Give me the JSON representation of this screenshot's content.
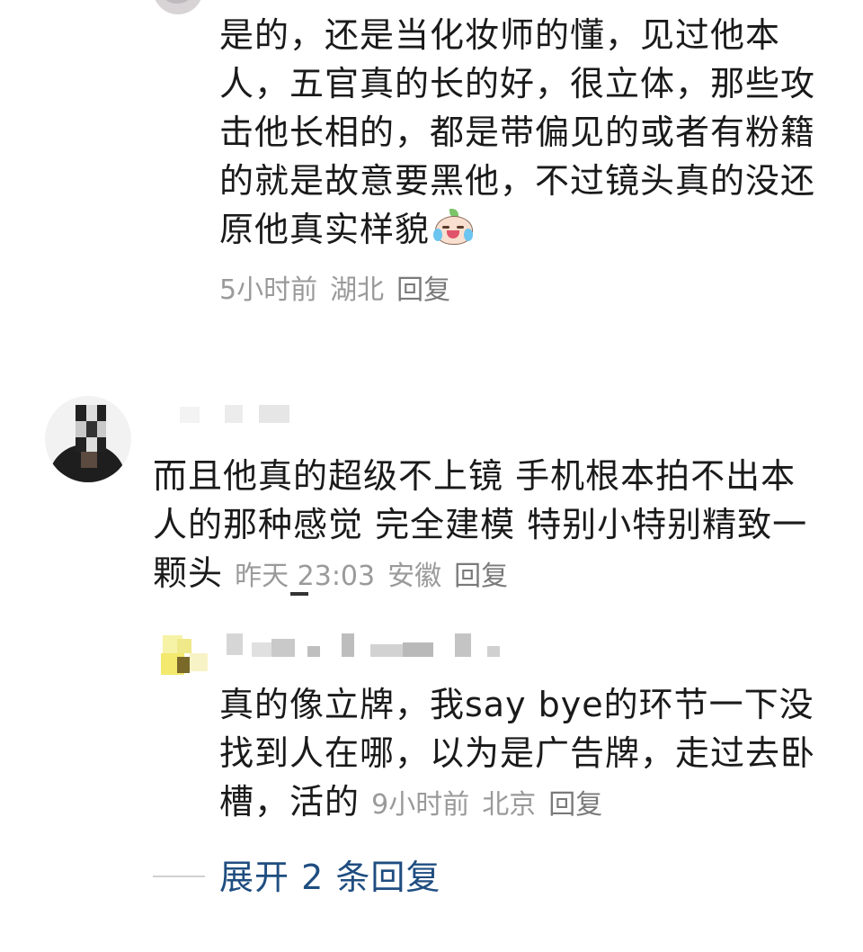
{
  "comments": [
    {
      "text": "是的，还是当化妆师的懂，见过他本人，五官真的长的好，很立体，那些攻击他长相的，都是带偏见的或者有粉籍的就是故意要黑他，不过镜头真的没还原他真实样貌",
      "emoji": "crying-face",
      "time": "5小时前",
      "location": "湖北",
      "reply_label": "回复"
    },
    {
      "text": "而且他真的超级不上镜 手机根本拍不出本人的那种感觉 完全建模 特别小特别精致一颗头",
      "time": "昨天 23:03",
      "location": "安徽",
      "reply_label": "回复",
      "replies": [
        {
          "text": "真的像立牌，我say bye的环节一下没找到人在哪，以为是广告牌，走过去卧槽，活的",
          "time": "9小时前",
          "location": "北京",
          "reply_label": "回复"
        }
      ],
      "expand_label": "展开 2 条回复"
    }
  ],
  "colors": {
    "text": "#1a1a1a",
    "meta": "#9a9a9a",
    "link": "#1f4d80"
  }
}
